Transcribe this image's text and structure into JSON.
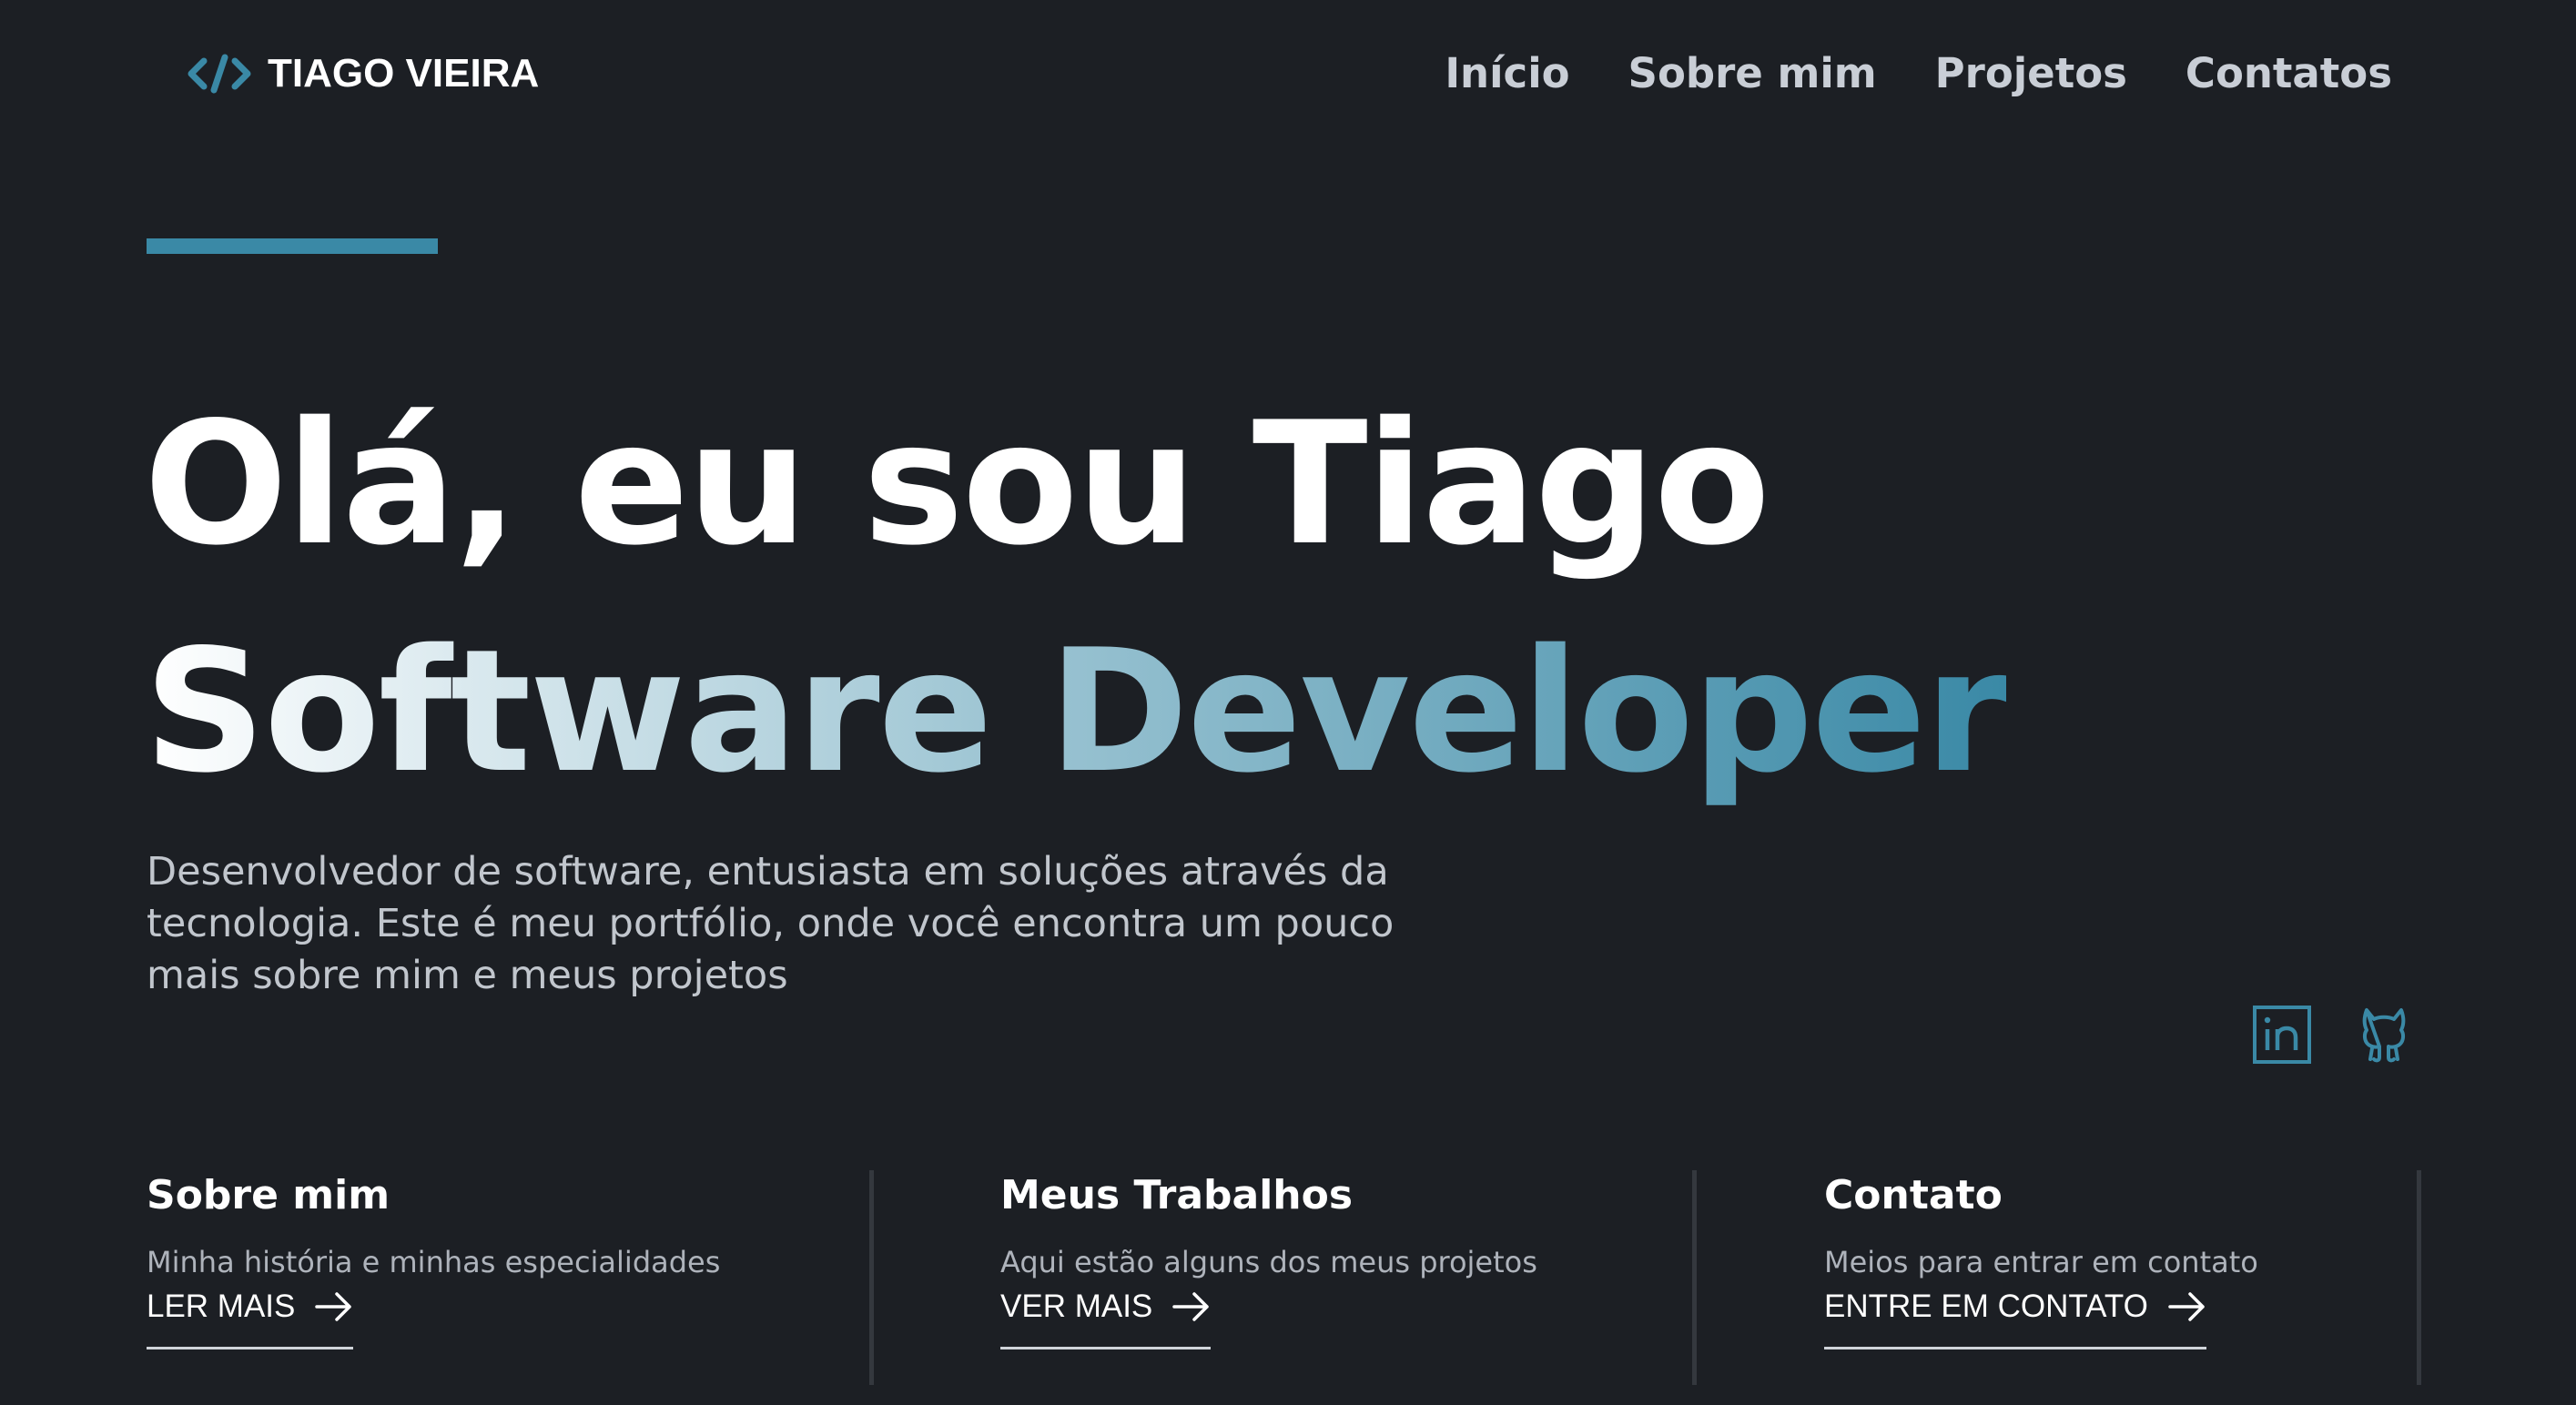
{
  "header": {
    "logo_text": "TIAGO VIEIRA",
    "logo_icon": "code-brackets-icon",
    "nav": [
      {
        "label": "Início"
      },
      {
        "label": "Sobre mim"
      },
      {
        "label": "Projetos"
      },
      {
        "label": "Contatos"
      }
    ]
  },
  "hero": {
    "title": "Olá, eu sou Tiago",
    "subtitle": "Software Developer",
    "description": "Desenvolvedor de software, entusiasta em soluções através da tecnologia. Este é meu portfólio, onde você encontra um pouco mais sobre mim e meus projetos"
  },
  "social": [
    {
      "icon": "linkedin-icon"
    },
    {
      "icon": "github-icon"
    }
  ],
  "cards": [
    {
      "title": "Sobre mim",
      "description": "Minha história e minhas especialidades",
      "link": "LER MAIS"
    },
    {
      "title": "Meus Trabalhos",
      "description": "Aqui estão alguns dos meus projetos",
      "link": "VER MAIS"
    },
    {
      "title": "Contato",
      "description": "Meios para entrar em contato",
      "link": "ENTRE EM CONTATO"
    }
  ],
  "colors": {
    "background": "#1c1f24",
    "accent": "#3a89a6",
    "text": "#ffffff",
    "muted": "#c1c6cd"
  }
}
